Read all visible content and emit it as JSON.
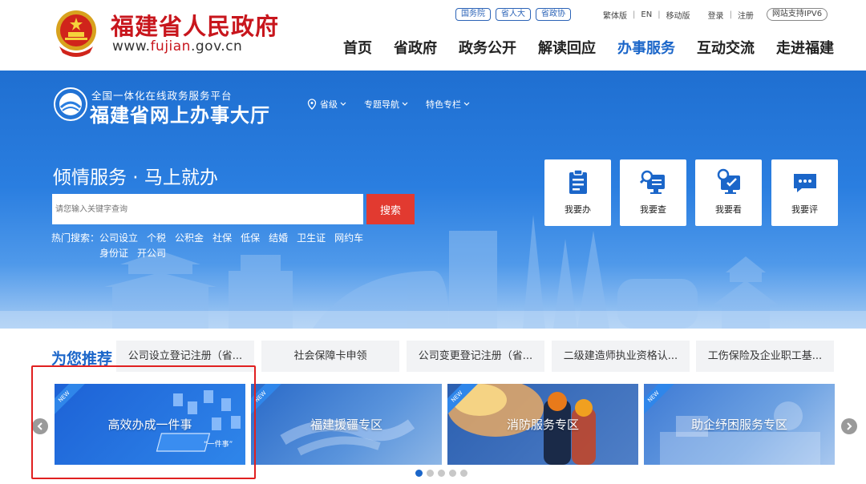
{
  "header": {
    "site_title": "福建省人民政府",
    "url_prefix": "www.",
    "url_highlight": "fujian",
    "url_suffix": ".gov.cn",
    "pill_links": [
      "国务院",
      "省人大",
      "省政协"
    ],
    "util_links": [
      "繁体版",
      "EN",
      "移动版"
    ],
    "auth_links": [
      "登录",
      "注册"
    ],
    "ipv6_badge": "网站支持IPV6",
    "nav": [
      "首页",
      "省政府",
      "政务公开",
      "解读回应",
      "办事服务",
      "互动交流",
      "走进福建"
    ],
    "active_nav": "办事服务"
  },
  "hall": {
    "subtitle": "全国一体化在线政务服务平台",
    "title": "福建省网上办事大厅",
    "nav": [
      "省级",
      "专题导航",
      "特色专栏"
    ]
  },
  "hero": {
    "slogan": "倾情服务 · 马上就办",
    "search_placeholder": "请您输入关键字查询",
    "search_button": "搜索",
    "hot_label": "热门搜索：",
    "hot_row1": [
      "公司设立",
      "个税",
      "公积金",
      "社保",
      "低保",
      "结婚",
      "卫生证",
      "网约车"
    ],
    "hot_row2": [
      "身份证",
      "开公司"
    ],
    "quick": [
      "我要办",
      "我要查",
      "我要看",
      "我要评"
    ]
  },
  "recommend": {
    "title": "为您推荐",
    "tabs": [
      "公司设立登记注册（省...",
      "社会保障卡申领",
      "公司变更登记注册（省...",
      "二级建造师执业资格认...",
      "工伤保险及企业职工基..."
    ]
  },
  "carousel": {
    "badge": "NEW",
    "cards": [
      "高效办成一件事",
      "福建援疆专区",
      "消防服务专区",
      "助企纾困服务专区"
    ],
    "inner_tag": "“一件事”",
    "page_count": 5,
    "active_page": 1
  },
  "colors": {
    "brand_red": "#c8161d",
    "brand_blue": "#1b66c9",
    "search_red": "#e23a30",
    "highlight_red": "#e02020"
  }
}
